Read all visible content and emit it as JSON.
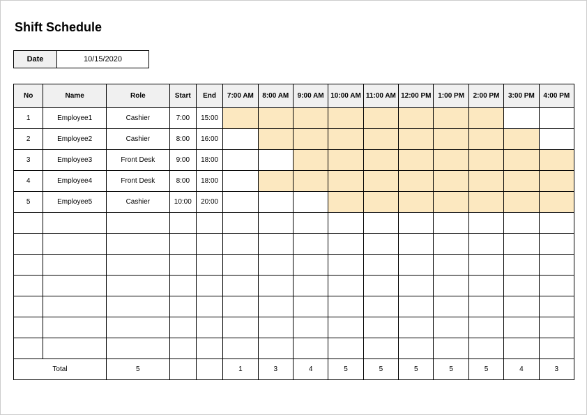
{
  "title": "Shift Schedule",
  "date_label": "Date",
  "date_value": "10/15/2020",
  "headers": {
    "no": "No",
    "name": "Name",
    "role": "Role",
    "start": "Start",
    "end": "End",
    "hours": [
      "7:00 AM",
      "8:00 AM",
      "9:00 AM",
      "10:00 AM",
      "11:00 AM",
      "12:00 PM",
      "1:00 PM",
      "2:00 PM",
      "3:00 PM",
      "4:00 PM"
    ]
  },
  "rows": [
    {
      "no": "1",
      "name": "Employee1",
      "role": "Cashier",
      "start": "7:00",
      "end": "15:00",
      "fill": [
        true,
        true,
        true,
        true,
        true,
        true,
        true,
        true,
        false,
        false
      ]
    },
    {
      "no": "2",
      "name": "Employee2",
      "role": "Cashier",
      "start": "8:00",
      "end": "16:00",
      "fill": [
        false,
        true,
        true,
        true,
        true,
        true,
        true,
        true,
        true,
        false
      ]
    },
    {
      "no": "3",
      "name": "Employee3",
      "role": "Front Desk",
      "start": "9:00",
      "end": "18:00",
      "fill": [
        false,
        false,
        true,
        true,
        true,
        true,
        true,
        true,
        true,
        true
      ]
    },
    {
      "no": "4",
      "name": "Employee4",
      "role": "Front Desk",
      "start": "8:00",
      "end": "18:00",
      "fill": [
        false,
        true,
        true,
        true,
        true,
        true,
        true,
        true,
        true,
        true
      ]
    },
    {
      "no": "5",
      "name": "Employee5",
      "role": "Cashier",
      "start": "10:00",
      "end": "20:00",
      "fill": [
        false,
        false,
        false,
        true,
        true,
        true,
        true,
        true,
        true,
        true
      ]
    }
  ],
  "empty_rows": 7,
  "total": {
    "label": "Total",
    "role_count": "5",
    "hours": [
      "1",
      "3",
      "4",
      "5",
      "5",
      "5",
      "5",
      "5",
      "4",
      "3"
    ]
  }
}
